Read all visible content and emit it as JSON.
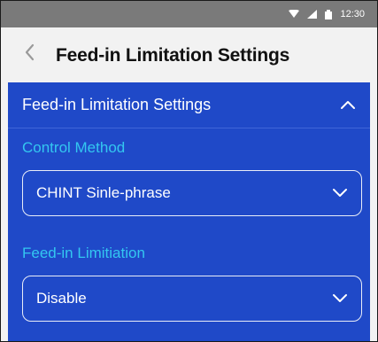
{
  "status_bar": {
    "time": "12:30",
    "icons": [
      "wifi-icon",
      "signal-icon",
      "battery-icon"
    ]
  },
  "header": {
    "back_icon": "chevron-left-icon",
    "title": "Feed-in Limitation Settings"
  },
  "panel": {
    "title": "Feed-in Limitation Settings",
    "expanded": true,
    "collapse_icon": "chevron-up-icon",
    "fields": [
      {
        "label": "Control Method",
        "value": "CHINT Sinle-phrase",
        "icon": "chevron-down-icon"
      },
      {
        "label": "Feed-in Limitiation",
        "value": "Disable",
        "icon": "chevron-down-icon"
      }
    ]
  },
  "colors": {
    "status_bar": "#7a7a7a",
    "header_bg": "#f2f2f2",
    "panel_bg": "#1f49c8",
    "field_label": "#33c7f0",
    "text_on_panel": "#ffffff"
  }
}
